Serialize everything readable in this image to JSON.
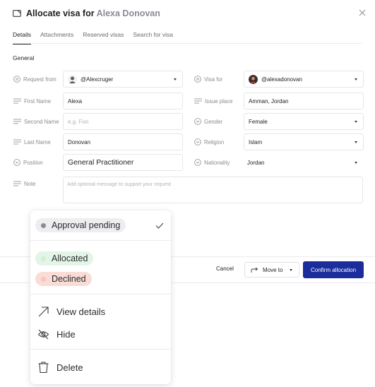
{
  "header": {
    "title": "Allocate visa for",
    "name": "Alexa Donovan"
  },
  "tabs": [
    {
      "label": "Details"
    },
    {
      "label": "Attachments"
    },
    {
      "label": "Reserved visas"
    },
    {
      "label": "Search for visa"
    }
  ],
  "section_title": "General",
  "form": {
    "request_from": {
      "label": "Request from",
      "value": "@Alexcruger"
    },
    "visa_for": {
      "label": "Visa for",
      "value": "@alexadonovan"
    },
    "first_name": {
      "label": "First Name",
      "value": "Alexa"
    },
    "issue_place": {
      "label": "Issue place",
      "value": "Amman, Jordan"
    },
    "second_name": {
      "label": "Second Name",
      "placeholder": "e.g. Fon"
    },
    "gender": {
      "label": "Gender",
      "value": "Female"
    },
    "last_name": {
      "label": "Last Name",
      "value": "Donovan"
    },
    "religion": {
      "label": "Religion",
      "value": "Islam"
    },
    "position": {
      "label": "Position",
      "value": "General Practitioner"
    },
    "nationality": {
      "label": "Nationality",
      "value": "Jordan"
    },
    "note": {
      "label": "Note",
      "placeholder": "Add optional message to support your request"
    }
  },
  "footer": {
    "cancel": "Cancel",
    "move_to": "Move to",
    "confirm": "Confirm allocation"
  },
  "menu": {
    "statuses": [
      {
        "label": "Approval pending",
        "bg": "#eeeef1",
        "dot": "#8b8b94",
        "selected": true
      },
      {
        "label": "Allocated",
        "bg": "#e3f5e6",
        "dot": "#cfeed5",
        "selected": false
      },
      {
        "label": "Declined",
        "bg": "#f9dcd5",
        "dot": "#f5c6bb",
        "selected": false
      }
    ],
    "actions": [
      {
        "label": "View details",
        "icon": "arrow-up-right-icon"
      },
      {
        "label": "Hide",
        "icon": "eye-off-icon"
      },
      {
        "label": "Delete",
        "icon": "trash-icon"
      }
    ]
  },
  "colors": {
    "primary": "#1b2c9c",
    "text": "#1f1f23",
    "muted": "#8b8b94"
  }
}
